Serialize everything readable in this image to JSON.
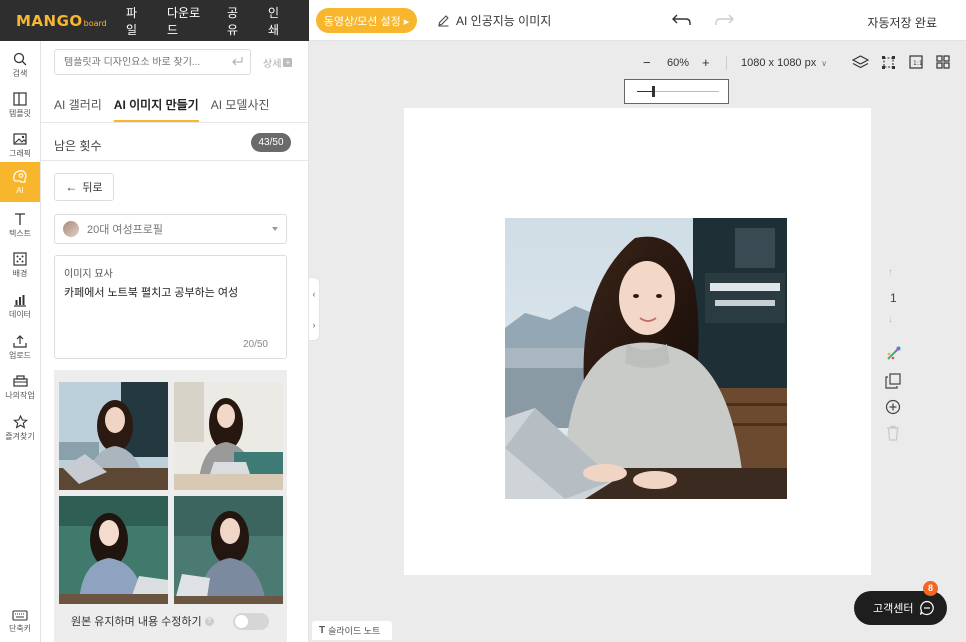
{
  "header": {
    "logo_main": "MANGO",
    "logo_sub": "board",
    "menu": [
      "파일",
      "다운로드",
      "공유",
      "인쇄"
    ],
    "motion_label": "동영상/모션 설정 ▸",
    "ai_image_label": "AI 인공지능 이미지",
    "autosave": "자동저장 완료"
  },
  "rail": {
    "items": [
      {
        "label": "검색",
        "icon": "search-icon"
      },
      {
        "label": "템플릿",
        "icon": "template-icon"
      },
      {
        "label": "그래픽",
        "icon": "graphic-icon"
      },
      {
        "label": "AI",
        "icon": "ai-icon"
      },
      {
        "label": "텍스트",
        "icon": "text-icon"
      },
      {
        "label": "배경",
        "icon": "background-icon"
      },
      {
        "label": "데이터",
        "icon": "data-icon"
      },
      {
        "label": "업로드",
        "icon": "upload-icon"
      },
      {
        "label": "나의작업",
        "icon": "my-work-icon"
      },
      {
        "label": "즐겨찾기",
        "icon": "star-icon"
      }
    ],
    "shortcut": "단축키"
  },
  "panel": {
    "search_placeholder": "템플릿과 디자인요소 바로 찾기...",
    "detail": "상세",
    "tabs": [
      "AI 갤러리",
      "AI 이미지 만들기",
      "AI 모델사진"
    ],
    "remain_label": "남은 횟수",
    "remain_count": "43/50",
    "back": "뒤로",
    "profile": "20대 여성프로필",
    "desc_label": "이미지 묘사",
    "desc_text": "카페에서 노트북 펼치고 공부하는 여성",
    "desc_count": "20/50",
    "keep_label": "원본 유지하며 내용 수정하기"
  },
  "canvas": {
    "zoom": "60%",
    "zoom_level": 0.2,
    "size": "1080 x 1080 px",
    "page_number": "1"
  },
  "footer": {
    "slide_note": "슬라이드 노트",
    "help": "고객센터",
    "help_badge": "8"
  },
  "colors": {
    "accent": "#f7b62b",
    "dark": "#2e2e2e"
  }
}
